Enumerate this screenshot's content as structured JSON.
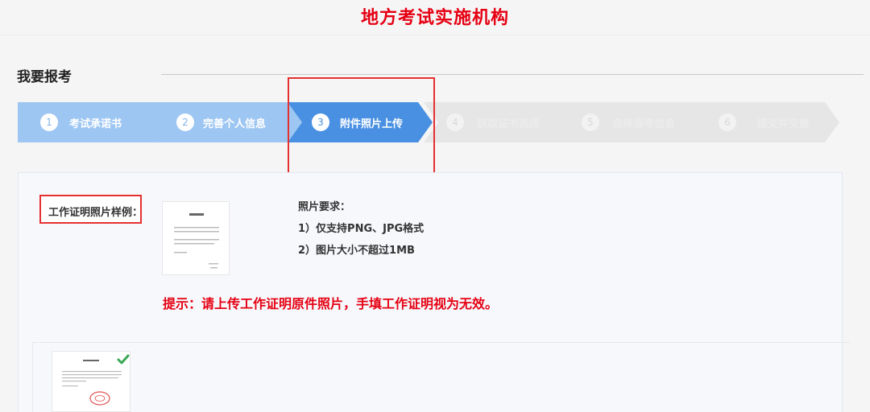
{
  "header": {
    "title": "地方考试实施机构"
  },
  "section": {
    "title": "我要报考"
  },
  "steps": [
    {
      "number": "1",
      "label": "考试承诺书",
      "status": "done"
    },
    {
      "number": "2",
      "label": "完善个人信息",
      "status": "done"
    },
    {
      "number": "3",
      "label": "附件照片上传",
      "status": "active"
    },
    {
      "number": "4",
      "label": "获取证书选择",
      "status": "pending"
    },
    {
      "number": "5",
      "label": "选择报考信息",
      "status": "pending"
    },
    {
      "number": "6",
      "label": "提交并交费",
      "status": "pending"
    }
  ],
  "colors": {
    "done": "#9dc6f2",
    "active": "#4a90e2",
    "pending": "#e6e6e6",
    "alert": "#e60012"
  },
  "upload": {
    "sample_label": "工作证明照片样例：",
    "requirements_title": "照片要求：",
    "requirements": [
      "1）仅支持PNG、JPG格式",
      "2）图片大小不超过1MB"
    ],
    "warning": "提示：请上传工作证明原件照片，手填工作证明视为无效。"
  },
  "icons": {
    "uploaded_check": "check-icon"
  }
}
